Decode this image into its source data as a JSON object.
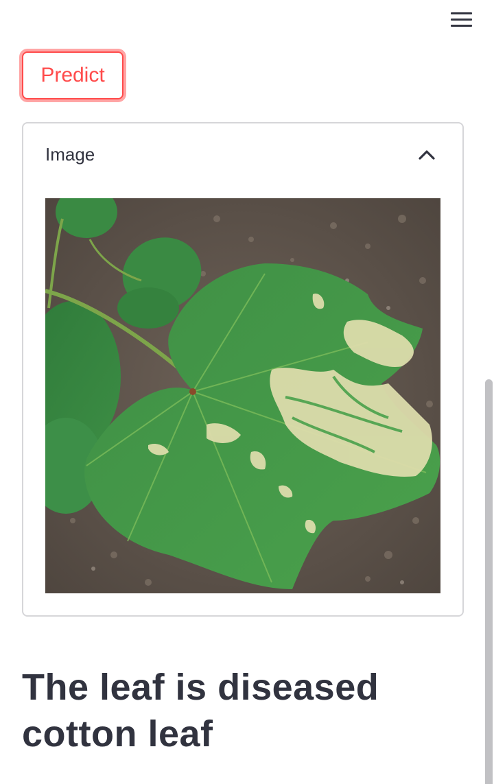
{
  "header": {
    "menu_icon": "hamburger-menu-icon"
  },
  "predict_button": {
    "label": "Predict",
    "accent_color": "#ff4b4b"
  },
  "expander": {
    "label": "Image",
    "expanded": true,
    "toggle_icon": "chevron-up-icon"
  },
  "result": {
    "text": "The leaf is diseased cotton leaf"
  },
  "colors": {
    "text": "#31333f",
    "accent": "#ff4b4b",
    "border": "#d6d6d9"
  }
}
